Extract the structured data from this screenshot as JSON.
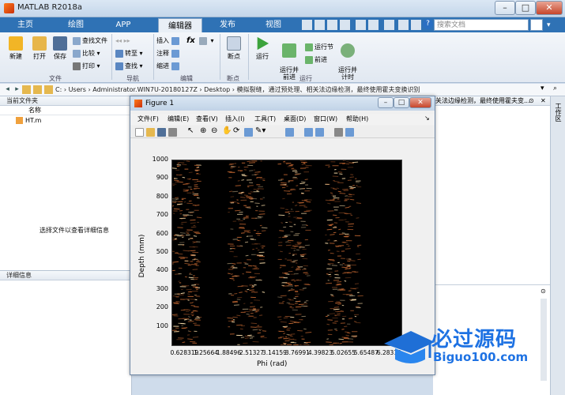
{
  "app": {
    "title": "MATLAB R2018a"
  },
  "tabs": [
    {
      "label": "主页"
    },
    {
      "label": "绘图"
    },
    {
      "label": "APP"
    },
    {
      "label": "编辑器"
    },
    {
      "label": "发布"
    },
    {
      "label": "视图"
    }
  ],
  "search": {
    "placeholder": "搜索文档"
  },
  "ribbon": {
    "file": {
      "new": "新建",
      "open": "打开",
      "save": "保存",
      "find_files": "查找文件",
      "compare": "比较",
      "print": "打印",
      "group": "文件"
    },
    "nav": {
      "goto": "转至",
      "find": "查找",
      "group": "导航"
    },
    "edit": {
      "insert": "插入",
      "comment": "注释",
      "indent": "缩进",
      "fx": "fx",
      "group": "编辑"
    },
    "breakpoint": {
      "bp": "断点",
      "group": "断点"
    },
    "run": {
      "run": "运行",
      "run_advance": "运行并\n前进",
      "run_section": "运行节",
      "advance": "前进",
      "run_time": "运行并\n计时",
      "group": "运行"
    }
  },
  "address": {
    "path": "C:  ›  Users  ›  Administrator.WIN7U-20180127Z  ›  Desktop  ›  模拟裂缝，通过预处理、相关法边缘检测，最终使用霍夫变换识别"
  },
  "current_folder": {
    "title": "当前文件夹",
    "name_col": "名称",
    "files": [
      "HT.m"
    ]
  },
  "details": {
    "title": "详细信息",
    "hint": "选择文件以查看详细信息"
  },
  "command": {
    "header_text": "关法边缘检测，最终使用霍夫变..."
  },
  "side_tab": "工作区",
  "figure": {
    "title": "Figure 1",
    "menus": [
      "文件(F)",
      "编辑(E)",
      "查看(V)",
      "插入(I)",
      "工具(T)",
      "桌面(D)",
      "窗口(W)",
      "帮助(H)"
    ],
    "ylabel": "Depth (mm)",
    "xlabel": "Phi (rad)",
    "yticks": [
      "1000",
      "900",
      "800",
      "700",
      "600",
      "500",
      "400",
      "300",
      "200",
      "100"
    ],
    "xticks": [
      "0.628319",
      "1.25664",
      "1.88496",
      "2.51327",
      "3.14159",
      "3.76991",
      "4.39823",
      "5.02655",
      "5.65487",
      "6.28319"
    ]
  },
  "chart_data": {
    "type": "heatmap",
    "title": "",
    "xlabel": "Phi (rad)",
    "ylabel": "Depth (mm)",
    "xlim": [
      0.314,
      6.6
    ],
    "ylim": [
      0,
      1000
    ],
    "x_ticks": [
      0.628319,
      1.25664,
      1.88496,
      2.51327,
      3.14159,
      3.76991,
      4.39823,
      5.02655,
      5.65487,
      6.28319
    ],
    "y_ticks": [
      100,
      200,
      300,
      400,
      500,
      600,
      700,
      800,
      900,
      1000
    ],
    "bright_bands_phi": [
      [
        0.3,
        1.0
      ],
      [
        1.8,
        2.8
      ],
      [
        3.2,
        4.0
      ],
      [
        4.5,
        5.4
      ]
    ],
    "grid": false
  },
  "watermark": {
    "cn": "必过源码",
    "url": "Biguo100.com"
  },
  "colors": {
    "tabbar": "#2f72b5",
    "accent": "#e9eff6",
    "heat_low": "#000000",
    "heat_high": "#f4c37a"
  }
}
